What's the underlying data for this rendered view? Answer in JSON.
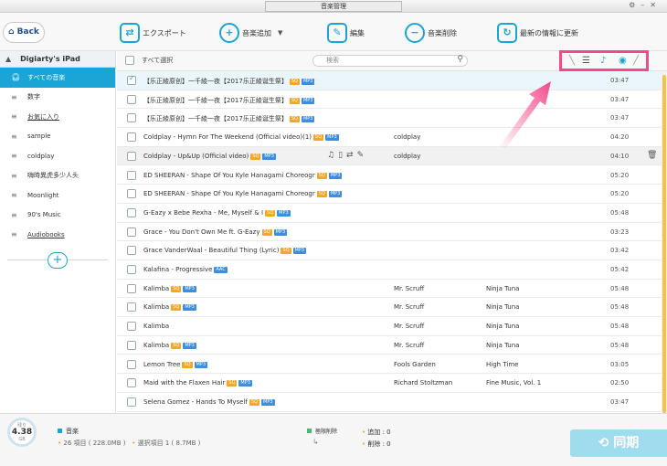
{
  "window": {
    "title": "音楽管理"
  },
  "toolbar": {
    "back_label": "Back",
    "export_label": "エクスポート",
    "add_label": "音楽追加",
    "edit_label": "編集",
    "delete_label": "音楽削除",
    "refresh_label": "最新の情報に更新"
  },
  "sidebar": {
    "device": "Digiarty's iPad",
    "items": [
      {
        "label": "すべての音楽",
        "active": true
      },
      {
        "label": "数字"
      },
      {
        "label": "お気に入り"
      },
      {
        "label": "sample"
      },
      {
        "label": "coldplay"
      },
      {
        "label": "嗨時異虎多少人头"
      },
      {
        "label": "Moonlight"
      },
      {
        "label": "90's Music"
      },
      {
        "label": "Audiobooks"
      }
    ]
  },
  "list": {
    "select_all": "すべて選択",
    "search_placeholder": "検索",
    "rows": [
      {
        "name": "【乐正綾原创】一千綾一夜【2017乐正綾诞生祭】",
        "badges": [
          "SQ",
          "MP3"
        ],
        "artist": "",
        "album": "",
        "duration": "03:47",
        "checked": true
      },
      {
        "name": "【乐正綾原创】一千綾一夜【2017乐正綾诞生祭】",
        "badges": [
          "SQ",
          "MP3"
        ],
        "artist": "",
        "album": "",
        "duration": "03:47"
      },
      {
        "name": "【乐正綾原创】一千綾一夜【2017乐正綾诞生祭】",
        "badges": [
          "SQ",
          "MP3"
        ],
        "artist": "",
        "album": "",
        "duration": "03:47"
      },
      {
        "name": "Coldplay - Hymn For The Weekend (Official video)(1)",
        "badges": [
          "SQ",
          "MP3"
        ],
        "artist": "coldplay",
        "album": "",
        "duration": "04:20"
      },
      {
        "name": "Coldplay - Up&Up (Official video)",
        "badges": [
          "SQ",
          "MP3"
        ],
        "artist": "coldplay",
        "album": "",
        "duration": "04:10",
        "hover": true
      },
      {
        "name": "ED SHEERAN - Shape Of You   Kyle Hanagami Choreogr",
        "badges": [
          "SQ",
          "MP3"
        ],
        "artist": "",
        "album": "",
        "duration": "05:20"
      },
      {
        "name": "ED SHEERAN - Shape Of You   Kyle Hanagami Choreogr",
        "badges": [
          "SQ",
          "MP3"
        ],
        "artist": "",
        "album": "",
        "duration": "05:20"
      },
      {
        "name": "G-Eazy x Bebe Rexha - Me, Myself & I",
        "badges": [
          "SQ",
          "MP3"
        ],
        "artist": "",
        "album": "",
        "duration": "05:48"
      },
      {
        "name": "Grace - You Don't Own Me ft. G-Eazy",
        "badges": [
          "SQ",
          "MP3"
        ],
        "artist": "",
        "album": "",
        "duration": "03:23"
      },
      {
        "name": "Grace VanderWaal - Beautiful Thing (Lyric)",
        "badges": [
          "SQ",
          "MP3"
        ],
        "artist": "",
        "album": "",
        "duration": "03:42"
      },
      {
        "name": "Kalafina - Progressive",
        "badges": [
          "AAC"
        ],
        "artist": "",
        "album": "",
        "duration": "05:42"
      },
      {
        "name": "Kalimba",
        "badges": [
          "SQ",
          "MP3"
        ],
        "artist": "Mr. Scruff",
        "album": "Ninja Tuna",
        "duration": "05:48"
      },
      {
        "name": "Kalimba",
        "badges": [
          "SQ",
          "MP3"
        ],
        "artist": "Mr. Scruff",
        "album": "Ninja Tuna",
        "duration": "05:48"
      },
      {
        "name": "Kalimba",
        "badges": [],
        "artist": "Mr. Scruff",
        "album": "Ninja Tuna",
        "duration": "05:48"
      },
      {
        "name": "Kalimba",
        "badges": [
          "SQ",
          "MP3"
        ],
        "artist": "Mr. Scruff",
        "album": "Ninja Tuna",
        "duration": "05:48"
      },
      {
        "name": "Lemon Tree",
        "badges": [
          "SQ",
          "MP3"
        ],
        "artist": "Fools Garden",
        "album": "High Time",
        "duration": "03:05"
      },
      {
        "name": "Maid with the Flaxen Hair",
        "badges": [
          "SQ",
          "MP3"
        ],
        "artist": "Richard Stoltzman",
        "album": "Fine Music, Vol. 1",
        "duration": "02:50"
      },
      {
        "name": "Selena Gomez - Hands To Myself",
        "badges": [
          "SQ",
          "MP3"
        ],
        "artist": "",
        "album": "",
        "duration": "03:47"
      }
    ]
  },
  "footer": {
    "storage_label": "残り",
    "storage_value": "4.38",
    "storage_unit": "GB",
    "music_label": "音楽",
    "items_text": "26 項目 ( 228.0MB )",
    "selected_text": "選択項目 1 ( 8.7MB )",
    "perm_delete": "極限削除",
    "added_text": "追加 :  0",
    "deleted_text": "削除 :  0",
    "sync_label": "同期"
  },
  "colors": {
    "accent": "#1aa5d6",
    "highlight": "#f44a8c",
    "badge_sq": "#f5a623",
    "badge_fmt": "#3d8ee0"
  }
}
